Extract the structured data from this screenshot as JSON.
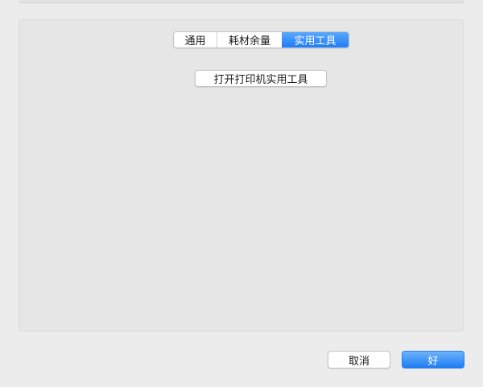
{
  "tabs": [
    {
      "label": "通用",
      "selected": false
    },
    {
      "label": "耗材余量",
      "selected": false
    },
    {
      "label": "实用工具",
      "selected": true
    }
  ],
  "panel": {
    "open_utility_label": "打开打印机实用工具"
  },
  "footer": {
    "cancel_label": "取消",
    "ok_label": "好"
  },
  "colors": {
    "accent": "#1f7cf5",
    "window_background": "#ececec",
    "panel_background": "#e6e6e6"
  }
}
